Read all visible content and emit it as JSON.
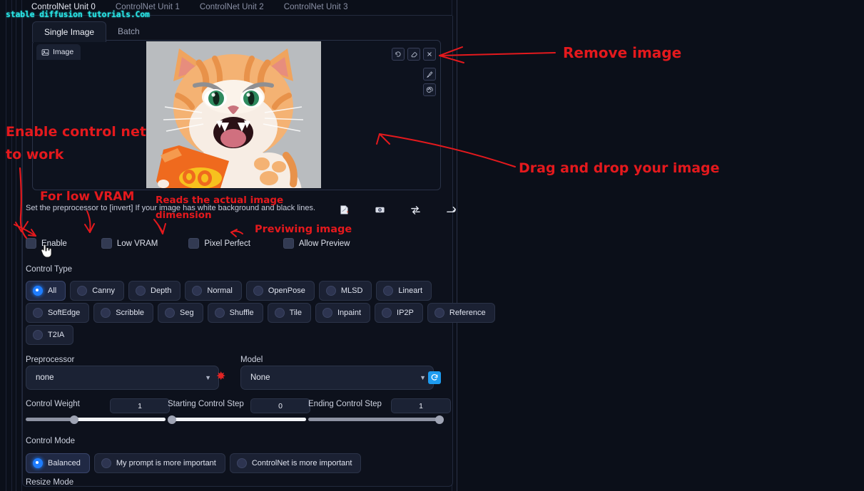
{
  "watermark": "stable diffusion tutorials.Com",
  "unit_tabs": [
    {
      "label": "ControlNet Unit 0",
      "active": true
    },
    {
      "label": "ControlNet Unit 1",
      "active": false
    },
    {
      "label": "ControlNet Unit 2",
      "active": false
    },
    {
      "label": "ControlNet Unit 3",
      "active": false
    }
  ],
  "sub_tabs": [
    {
      "label": "Single Image",
      "active": true
    },
    {
      "label": "Batch",
      "active": false
    }
  ],
  "image_panel": {
    "tab_label": "Image",
    "tab_icon": "picture-icon",
    "tools_top": [
      "undo-icon",
      "eraser-icon",
      "close-icon"
    ],
    "tools_side": [
      "brush-icon",
      "color-palette-icon"
    ],
    "photo_alt": "angry orange tabby cat holding snack bag"
  },
  "hint": "Set the preprocessor to [invert] If your image has white background and black lines.",
  "icon_row": [
    "open-new-canvas-icon",
    "webcam-icon",
    "swap-icon",
    "send-icon"
  ],
  "checkboxes": [
    {
      "label": "Enable",
      "checked": false
    },
    {
      "label": "Low VRAM",
      "checked": false
    },
    {
      "label": "Pixel Perfect",
      "checked": false
    },
    {
      "label": "Allow Preview",
      "checked": false
    }
  ],
  "control_type": {
    "label": "Control Type",
    "options": [
      {
        "label": "All",
        "selected": true
      },
      {
        "label": "Canny",
        "selected": false
      },
      {
        "label": "Depth",
        "selected": false
      },
      {
        "label": "Normal",
        "selected": false
      },
      {
        "label": "OpenPose",
        "selected": false
      },
      {
        "label": "MLSD",
        "selected": false
      },
      {
        "label": "Lineart",
        "selected": false
      },
      {
        "label": "SoftEdge",
        "selected": false
      },
      {
        "label": "Scribble",
        "selected": false
      },
      {
        "label": "Seg",
        "selected": false
      },
      {
        "label": "Shuffle",
        "selected": false
      },
      {
        "label": "Tile",
        "selected": false
      },
      {
        "label": "Inpaint",
        "selected": false
      },
      {
        "label": "IP2P",
        "selected": false
      },
      {
        "label": "Reference",
        "selected": false
      },
      {
        "label": "T2IA",
        "selected": false
      }
    ]
  },
  "preprocessor": {
    "label": "Preprocessor",
    "value": "none"
  },
  "model": {
    "label": "Model",
    "value": "None"
  },
  "sliders": [
    {
      "label": "Control Weight",
      "value": "1",
      "percent": 35
    },
    {
      "label": "Starting Control Step",
      "value": "0",
      "percent": 0
    },
    {
      "label": "Ending Control Step",
      "value": "1",
      "percent": 100
    }
  ],
  "control_mode": {
    "label": "Control Mode",
    "options": [
      {
        "label": "Balanced",
        "selected": true
      },
      {
        "label": "My prompt is more important",
        "selected": false
      },
      {
        "label": "ControlNet is more important",
        "selected": false
      }
    ]
  },
  "resize_mode_label": "Resize Mode",
  "annotations": [
    {
      "id": "a1",
      "text": "Remove image"
    },
    {
      "id": "a2",
      "text": "Drag and drop your image"
    },
    {
      "id": "a3",
      "text": "Enable control net"
    },
    {
      "id": "a4",
      "text": "to work"
    },
    {
      "id": "a5",
      "text": "For low VRAM"
    },
    {
      "id": "a6",
      "text": "Reads the actual image"
    },
    {
      "id": "a7",
      "text": "dimension"
    },
    {
      "id": "a8",
      "text": "Previwing image"
    }
  ],
  "colors": {
    "accent_blue": "#1f7dff",
    "annotation_red": "#e4191d",
    "watermark_cyan": "#29e6e6",
    "refresh_blue": "#1d9bf0"
  }
}
